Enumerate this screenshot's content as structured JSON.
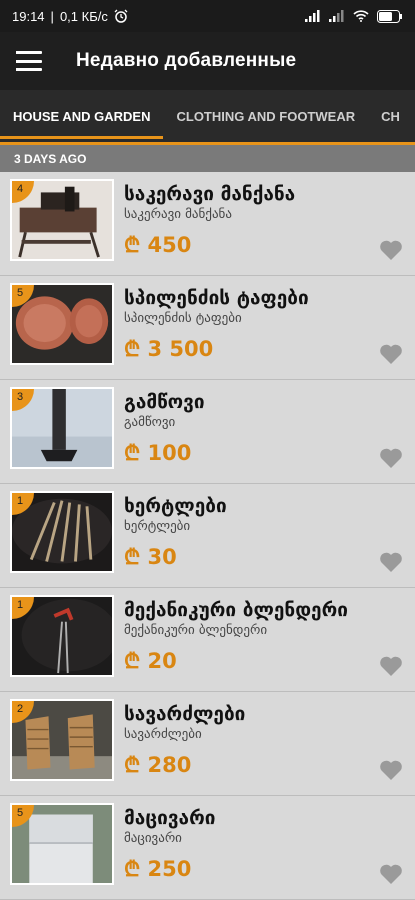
{
  "status": {
    "time": "19:14",
    "speed": "0,1 КБ/с",
    "battery": "59"
  },
  "appbar": {
    "title": "Недавно добавленные",
    "menu_icon": "hamburger-menu-icon"
  },
  "tabs": [
    {
      "label": "HOUSE AND GARDEN",
      "active": true
    },
    {
      "label": "CLOTHING AND FOOTWEAR",
      "active": false
    },
    {
      "label": "CH",
      "active": false
    }
  ],
  "section": {
    "label": "3 DAYS AGO"
  },
  "colors": {
    "accent": "#e8941a",
    "price": "#d98612",
    "appbar": "#1f1f1f"
  },
  "items": [
    {
      "badge": "4",
      "name": "საკერავი მანქანა",
      "sub": "საკერავი მანქანა",
      "price": "₾ 450",
      "thumb": "sewing-machine"
    },
    {
      "badge": "5",
      "name": "სპილენძის ტაფები",
      "sub": "სპილენძის ტაფები",
      "price": "₾ 3 500",
      "thumb": "copper-pans"
    },
    {
      "badge": "3",
      "name": "გამწოვი",
      "sub": "გამწოვი",
      "price": "₾ 100",
      "thumb": "chimney"
    },
    {
      "badge": "1",
      "name": "ხერტლები",
      "sub": "ხერტლები",
      "price": "₾ 30",
      "thumb": "spindles"
    },
    {
      "badge": "1",
      "name": "მექანიკური ბლენდერი",
      "sub": "მექანიკური ბლენდერი",
      "price": "₾ 20",
      "thumb": "blender"
    },
    {
      "badge": "2",
      "name": "სავარძლები",
      "sub": "სავარძლები",
      "price": "₾ 280",
      "thumb": "chairs"
    },
    {
      "badge": "5",
      "name": "მაცივარი",
      "sub": "მაცივარი",
      "price": "₾ 250",
      "thumb": "fridge"
    }
  ]
}
